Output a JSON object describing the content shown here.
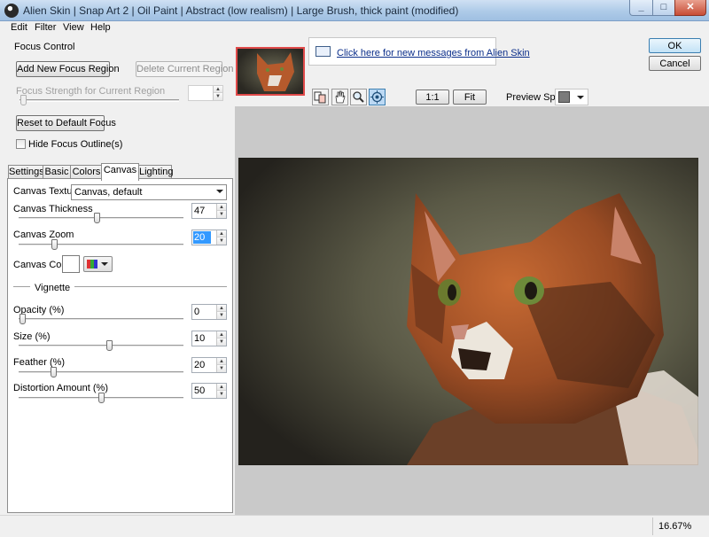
{
  "window": {
    "title": "Alien Skin | Snap Art 2 | Oil Paint | Abstract (low realism) | Large Brush, thick paint (modified)",
    "min_glyph": "_",
    "max_glyph": "□",
    "close_glyph": "✕"
  },
  "menu": [
    "Edit",
    "Filter",
    "View",
    "Help"
  ],
  "focus": {
    "group_label": "Focus Control",
    "add_label": "Add New Focus Region",
    "delete_label": "Delete Current Region",
    "strength_label": "Focus Strength for Current Region",
    "strength_value": "",
    "reset_label": "Reset to Default Focus",
    "hide_outline_label": "Hide Focus Outline(s)",
    "hide_outline_checked": false
  },
  "tabs": [
    "Settings",
    "Basic",
    "Colors",
    "Canvas",
    "Lighting"
  ],
  "active_tab": "Canvas",
  "canvas": {
    "texture_label": "Canvas Texture:",
    "texture_value": "Canvas, default",
    "thickness_label": "Canvas Thickness",
    "thickness_value": "47",
    "zoom_label": "Canvas Zoom",
    "zoom_value": "20",
    "color_label": "Canvas Color",
    "color_swatch": "#ffffff",
    "vignette_label": "Vignette",
    "opacity_label": "Opacity (%)",
    "opacity_value": "0",
    "size_label": "Size (%)",
    "size_value": "10",
    "feather_label": "Feather (%)",
    "feather_value": "20",
    "distortion_label": "Distortion Amount (%)",
    "distortion_value": "50"
  },
  "preview": {
    "message": "Click here for new messages from Alien Skin",
    "ok_label": "OK",
    "cancel_label": "Cancel",
    "one_to_one_label": "1:1",
    "fit_label": "Fit",
    "split_label": "Preview Split:",
    "tools": [
      "compare-icon",
      "hand-icon",
      "zoom-icon",
      "focus-target-icon"
    ],
    "selected_tool": "focus-target-icon"
  },
  "status": {
    "zoom": "16.67%"
  }
}
